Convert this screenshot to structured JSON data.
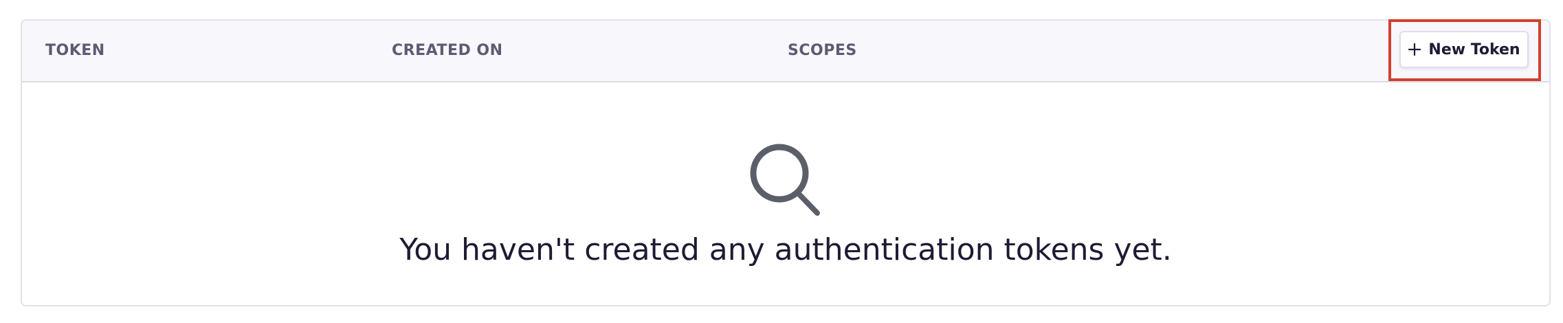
{
  "table": {
    "columns": [
      "TOKEN",
      "CREATED ON",
      "SCOPES"
    ],
    "new_token_label": "New Token",
    "empty_message": "You haven't created any authentication tokens yet."
  },
  "icons": {
    "add": "plus-icon",
    "empty": "search-icon"
  },
  "colors": {
    "header_bg": "#f8f7fb",
    "header_text": "#5f5a73",
    "border": "#e2e1ea",
    "highlight": "#d0402e",
    "icon_gray": "#5b5f68",
    "text_dark": "#201a33"
  }
}
